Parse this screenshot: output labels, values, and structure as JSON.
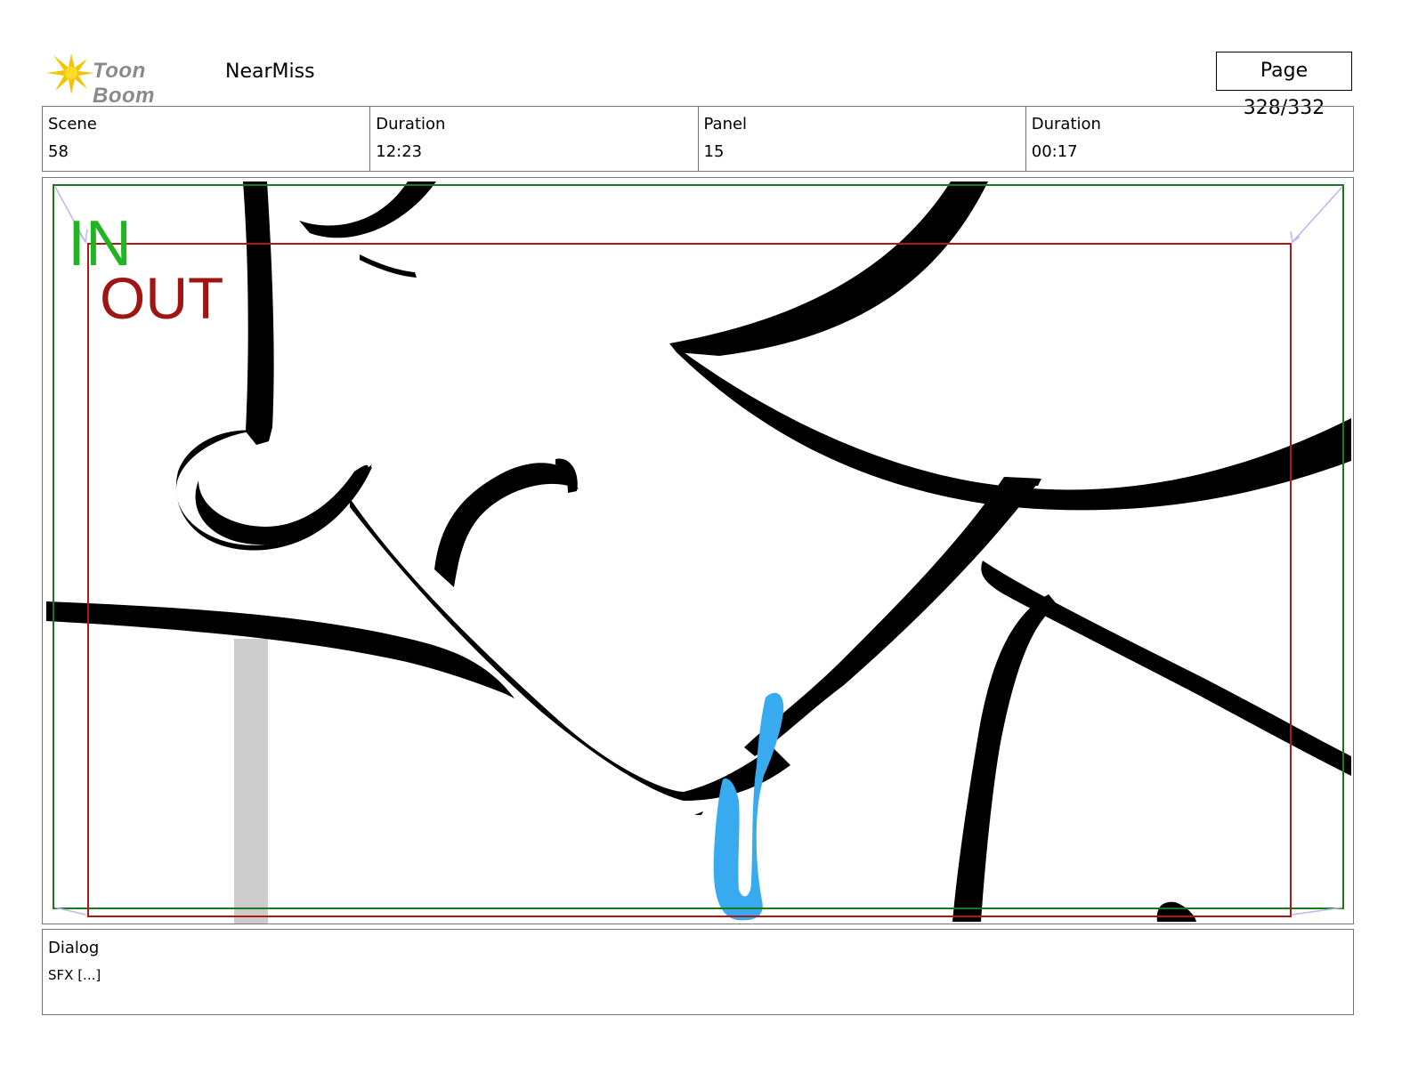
{
  "header": {
    "logo_text": "Toon Boom",
    "project_name": "NearMiss",
    "page_label": "Page 328/332"
  },
  "info": [
    {
      "label": "Scene",
      "value": "58"
    },
    {
      "label": "Duration",
      "value": "12:23"
    },
    {
      "label": "Panel",
      "value": "15"
    },
    {
      "label": "Duration",
      "value": "00:17"
    }
  ],
  "panel": {
    "in_label": "IN",
    "out_label": "OUT",
    "colors": {
      "in_frame": "#1a7a1a",
      "in_text": "#22b422",
      "out_frame": "#b01818",
      "out_text": "#a01414",
      "drip": "#38aaf0",
      "ink": "#000000",
      "gray_bar": "#cccccc",
      "corner_arrows": "#b8b8ee"
    }
  },
  "dialog": {
    "label": "Dialog",
    "text": "SFX [...]"
  }
}
